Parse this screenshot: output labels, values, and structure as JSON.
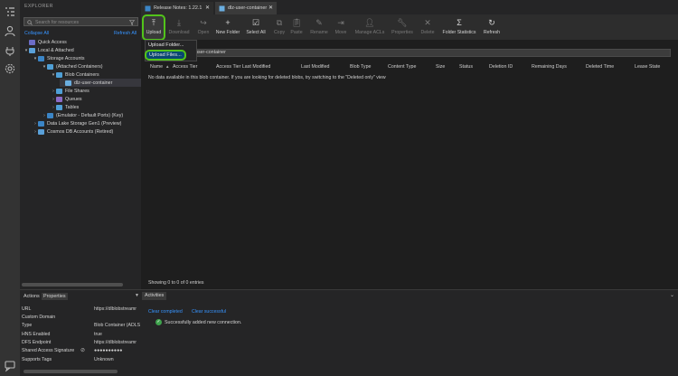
{
  "explorer": {
    "title": "EXPLORER",
    "search_placeholder": "Search for resources",
    "collapse_all": "Collapse All",
    "refresh_all": "Refresh All",
    "tree": [
      {
        "label": "Quick Access"
      },
      {
        "label": "Local & Attached"
      },
      {
        "label": "Storage Accounts"
      },
      {
        "label": "(Attached Containers)"
      },
      {
        "label": "Blob Containers"
      },
      {
        "label": "dlz-user-container"
      },
      {
        "label": "File Shares"
      },
      {
        "label": "Queues"
      },
      {
        "label": "Tables"
      },
      {
        "label": "(Emulator - Default Ports) (Key)"
      },
      {
        "label": "Data Lake Storage Gen1 (Preview)"
      },
      {
        "label": "Cosmos DB Accounts (Retired)"
      }
    ]
  },
  "tabs": [
    {
      "label": "Release Notes: 1.22.1"
    },
    {
      "label": "dlz-user-container"
    }
  ],
  "toolbar": {
    "upload": "Upload",
    "download": "Download",
    "open": "Open",
    "new_folder": "New Folder",
    "select_all": "Select All",
    "copy": "Copy",
    "paste": "Paste",
    "rename": "Rename",
    "move": "Move",
    "manage_acls": "Manage ACLs",
    "properties": "Properties",
    "delete": "Delete",
    "folder_statistics": "Folder Statistics",
    "refresh": "Refresh"
  },
  "upload_menu": {
    "folder": "Upload Folder...",
    "files": "Upload Files..."
  },
  "address": {
    "path": "user-container"
  },
  "table": {
    "columns": [
      "Name",
      "Access Tier",
      "Access Tier Last Modified",
      "Last Modified",
      "Blob Type",
      "Content Type",
      "Size",
      "Status",
      "Deletion ID",
      "Remaining Days",
      "Deleted Time",
      "Lease State"
    ],
    "empty_message": "No data available in this blob container. If you are looking for deleted blobs, try switching to the \"Deleted only\" view",
    "status": "Showing 0 to 0 of 0 entries"
  },
  "properties_panel": {
    "tab_actions": "Actions",
    "tab_properties": "Properties",
    "rows": [
      {
        "key": "URL",
        "value": "https://dlblobstreamr"
      },
      {
        "key": "Custom Domain",
        "value": ""
      },
      {
        "key": "Type",
        "value": "Blob Container (ADLS"
      },
      {
        "key": "HNS Enabled",
        "value": "true"
      },
      {
        "key": "DFS Endpoint",
        "value": "https://dlblobstreamr"
      },
      {
        "key": "Shared Access Signature",
        "value": "●●●●●●●●●●"
      },
      {
        "key": "Supports Tags",
        "value": "Unknown"
      }
    ]
  },
  "activities": {
    "tab": "Activities",
    "clear_completed": "Clear completed",
    "clear_successful": "Clear successful",
    "item": "Successfully added new connection."
  },
  "colors": {
    "accent_link": "#3794ff",
    "highlight_green": "#52c41a",
    "success": "#3fa34d"
  }
}
